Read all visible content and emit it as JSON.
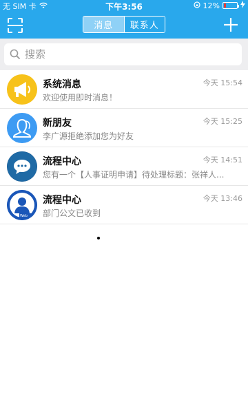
{
  "status_bar": {
    "carrier": "无 SIM 卡",
    "time": "下午3:56",
    "battery": "12%"
  },
  "header": {
    "tabs": [
      {
        "label": "消息",
        "active": true
      },
      {
        "label": "联系人",
        "active": false
      }
    ],
    "scan_icon": "scan-icon",
    "add_icon": "plus-icon"
  },
  "search": {
    "placeholder": "搜索"
  },
  "conversations": [
    {
      "name": "系统消息",
      "time": "今天 15:54",
      "preview": "欢迎使用即时消息！",
      "avatar": "megaphone-icon"
    },
    {
      "name": "新朋友",
      "time": "今天 15:25",
      "preview": "李广源拒绝添加您为好友",
      "avatar": "person-outline-icon"
    },
    {
      "name": "流程中心",
      "time": "今天 14:51",
      "preview": "您有一个【人事证明申请】待处理标题：张祥人...",
      "avatar": "chat-bubble-icon"
    },
    {
      "name": "流程中心",
      "time": "今天 13:46",
      "preview": "部门公文已收到",
      "avatar": "user-silhouette-icon",
      "avatar_label": "Web"
    }
  ],
  "colors": {
    "primary": "#29a8ec",
    "search_bg": "#eeeef0"
  }
}
